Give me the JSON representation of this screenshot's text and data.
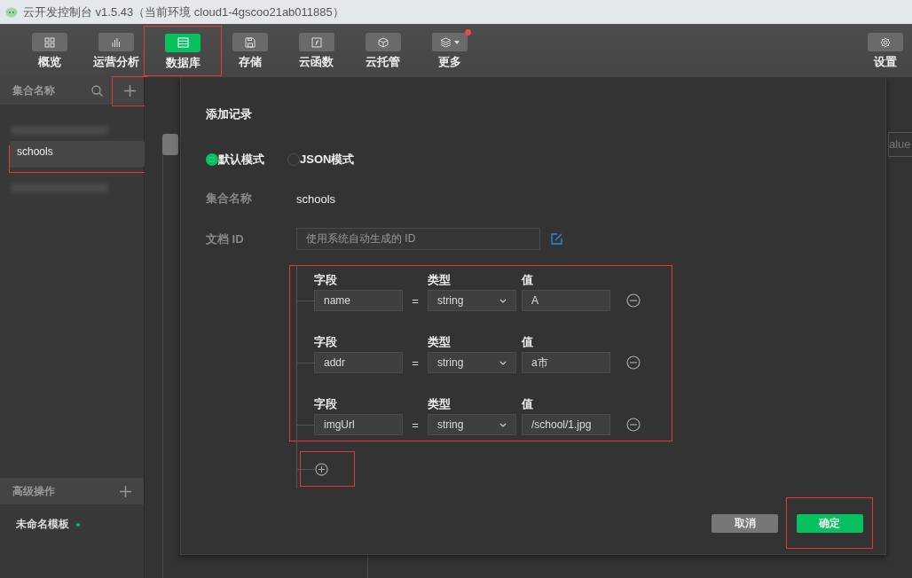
{
  "window": {
    "title": "云开发控制台 v1.5.43（当前环境 cloud1-4gscoo21ab011885）"
  },
  "toolbar": {
    "items": [
      {
        "label": "概览",
        "selected": false,
        "highlighted": false,
        "badge": false
      },
      {
        "label": "运营分析",
        "selected": false,
        "highlighted": false,
        "badge": false
      },
      {
        "label": "数据库",
        "selected": true,
        "highlighted": true,
        "badge": false
      },
      {
        "label": "存储",
        "selected": false,
        "highlighted": false,
        "badge": false
      },
      {
        "label": "云函数",
        "selected": false,
        "highlighted": false,
        "badge": false
      },
      {
        "label": "云托管",
        "selected": false,
        "highlighted": false,
        "badge": false
      },
      {
        "label": "更多",
        "selected": false,
        "highlighted": false,
        "badge": true
      }
    ],
    "settings": {
      "label": "设置"
    }
  },
  "sidebar": {
    "header": "集合名称",
    "add_highlighted": true,
    "collections": [
      {
        "kind": "blurred"
      },
      {
        "kind": "collection",
        "name": "schools",
        "selected": true,
        "highlighted": true
      },
      {
        "kind": "blurred"
      }
    ],
    "advanced": {
      "header": "高级操作",
      "templates": [
        {
          "name": "未命名模板",
          "color": "#07c160"
        }
      ]
    }
  },
  "background": {
    "filter_text": "alue"
  },
  "dialog": {
    "title": "添加记录",
    "modes": [
      {
        "label": "默认模式",
        "selected": true
      },
      {
        "label": "JSON模式",
        "selected": false
      }
    ],
    "collection_label": "集合名称",
    "collection_value": "schools",
    "doc_id_label": "文档 ID",
    "doc_id_placeholder": "使用系统自动生成的 ID",
    "fields_highlighted": true,
    "fields": [
      {
        "field_label": "字段",
        "field": "name",
        "equals": "=",
        "type_label": "类型",
        "type": "string",
        "value_label": "值",
        "value": "A"
      },
      {
        "field_label": "字段",
        "field": "addr",
        "equals": "=",
        "type_label": "类型",
        "type": "string",
        "value_label": "值",
        "value": "a市"
      },
      {
        "field_label": "字段",
        "field": "imgUrl",
        "equals": "=",
        "type_label": "类型",
        "type": "string",
        "value_label": "值",
        "value": "/school/1.jpg"
      }
    ],
    "add_highlighted": true,
    "buttons": [
      {
        "label": "取消",
        "kind": "secondary",
        "highlighted": false
      },
      {
        "label": "确定",
        "kind": "primary",
        "highlighted": true
      }
    ]
  }
}
